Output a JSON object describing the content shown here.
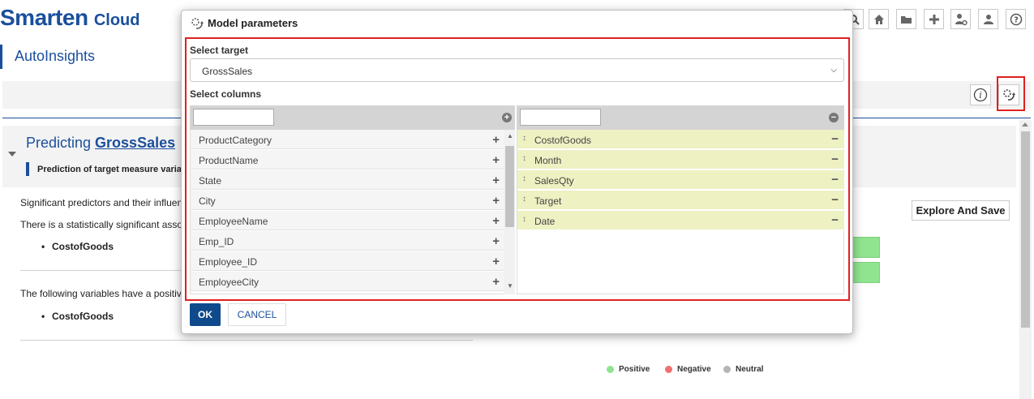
{
  "app": {
    "brand_name": "Smarten",
    "brand_suffix": "Cloud",
    "page_title": "AutoInsights",
    "brand_color": "#1b4f9c",
    "highlight_color": "#e02020"
  },
  "toolbar": {
    "icons": [
      "search-icon",
      "home-icon",
      "folder-icon",
      "plus-icon",
      "user-settings-icon",
      "user-icon",
      "help-icon"
    ]
  },
  "insight": {
    "title_prefix": "Predicting ",
    "target_name": "GrossSales",
    "subtitle": "Prediction of target measure varia",
    "line1": "Significant predictors and their influen",
    "line2": "There is a statistically significant asso",
    "bullet1": "CostofGoods",
    "line3": "The following variables have a positiv",
    "bullet2": "CostofGoods",
    "explore_label": "Explore And Save",
    "positive_bars_count": 2,
    "legend": [
      {
        "label": "Positive",
        "color": "#90e490"
      },
      {
        "label": "Negative",
        "color": "#f07070"
      },
      {
        "label": "Neutral",
        "color": "#b5b5b5"
      }
    ]
  },
  "modal": {
    "title": "Model parameters",
    "target_label": "Select target",
    "target_value": "GrossSales",
    "columns_label": "Select columns",
    "available_filter": "",
    "selected_filter": "",
    "available_columns": [
      "ProductCategory",
      "ProductName",
      "State",
      "City",
      "EmployeeName",
      "Emp_ID",
      "Employee_ID",
      "EmployeeCity"
    ],
    "selected_columns": [
      "CostofGoods",
      "Month",
      "SalesQty",
      "Target",
      "Date"
    ],
    "ok_label": "OK",
    "cancel_label": "CANCEL"
  }
}
